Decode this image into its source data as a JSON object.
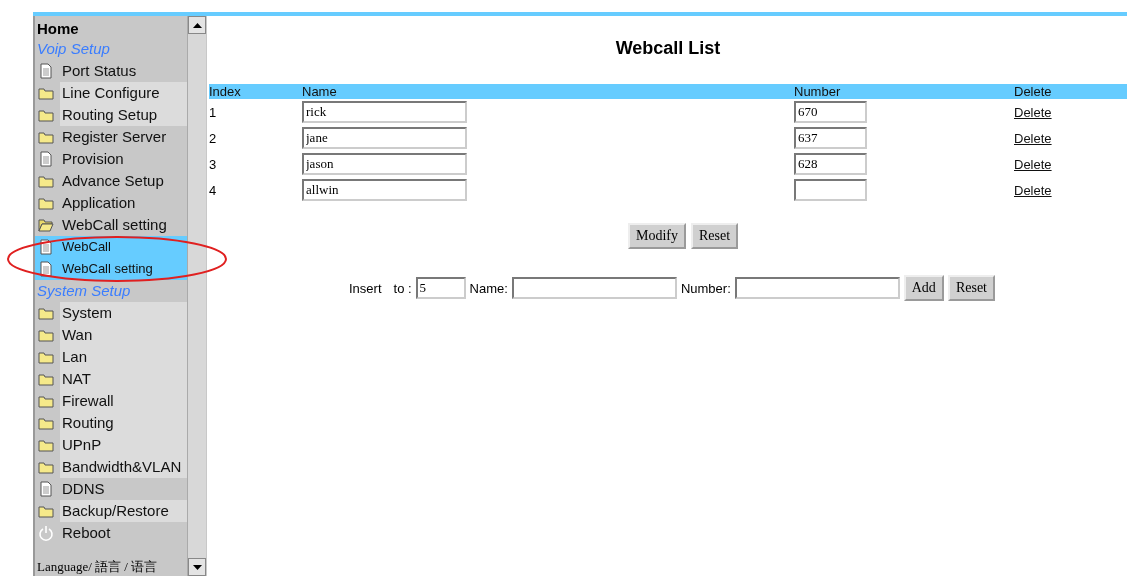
{
  "sidebar": {
    "items": [
      {
        "kind": "header",
        "label": "Home"
      },
      {
        "kind": "section",
        "label": "Voip Setup"
      },
      {
        "kind": "page",
        "label": "Port Status",
        "highlighted": false,
        "selected": false
      },
      {
        "kind": "folder",
        "label": "Line Configure",
        "highlighted": true,
        "selected": false
      },
      {
        "kind": "folder",
        "label": "Routing Setup",
        "highlighted": true,
        "selected": false
      },
      {
        "kind": "folder",
        "label": "Register Server",
        "highlighted": false,
        "selected": false
      },
      {
        "kind": "page",
        "label": "Provision",
        "highlighted": false,
        "selected": false
      },
      {
        "kind": "folder",
        "label": "Advance Setup",
        "highlighted": false,
        "selected": false
      },
      {
        "kind": "folder",
        "label": "Application",
        "highlighted": false,
        "selected": false
      },
      {
        "kind": "open-folder",
        "label": "WebCall setting",
        "highlighted": false,
        "selected": false
      },
      {
        "kind": "page",
        "label": "WebCall",
        "highlighted": false,
        "selected": true
      },
      {
        "kind": "page",
        "label": "WebCall setting",
        "highlighted": false,
        "selected": true
      },
      {
        "kind": "section",
        "label": "System Setup"
      },
      {
        "kind": "folder",
        "label": "System",
        "highlighted": true,
        "selected": false
      },
      {
        "kind": "folder",
        "label": "Wan",
        "highlighted": true,
        "selected": false
      },
      {
        "kind": "folder",
        "label": "Lan",
        "highlighted": true,
        "selected": false
      },
      {
        "kind": "folder",
        "label": "NAT",
        "highlighted": true,
        "selected": false
      },
      {
        "kind": "folder",
        "label": "Firewall",
        "highlighted": true,
        "selected": false
      },
      {
        "kind": "folder",
        "label": "Routing",
        "highlighted": true,
        "selected": false
      },
      {
        "kind": "folder",
        "label": "UPnP",
        "highlighted": true,
        "selected": false
      },
      {
        "kind": "folder",
        "label": "Bandwidth&VLAN",
        "highlighted": true,
        "selected": false
      },
      {
        "kind": "page",
        "label": "DDNS",
        "highlighted": false,
        "selected": false
      },
      {
        "kind": "folder",
        "label": "Backup/Restore",
        "highlighted": true,
        "selected": false
      },
      {
        "kind": "power",
        "label": "Reboot",
        "highlighted": false,
        "selected": false
      }
    ],
    "language": "Language/ 語言 / 语言"
  },
  "title": "Webcall List",
  "table": {
    "columns": [
      "Index",
      "Name",
      "Number",
      "Delete"
    ],
    "rows": [
      {
        "index": "1",
        "name": "rick",
        "number": "670",
        "delete": "Delete"
      },
      {
        "index": "2",
        "name": "jane",
        "number": "637",
        "delete": "Delete"
      },
      {
        "index": "3",
        "name": "jason",
        "number": "628",
        "delete": "Delete"
      },
      {
        "index": "4",
        "name": "allwin",
        "delete": "Delete"
      }
    ]
  },
  "buttons": [
    "Modify",
    "Reset"
  ],
  "insert": {
    "label": "Insert",
    "to_label": "to :",
    "to_value": "5",
    "name_label": "Name:",
    "number_label": "Number:",
    "buttons": [
      "Add",
      "Reset"
    ]
  }
}
